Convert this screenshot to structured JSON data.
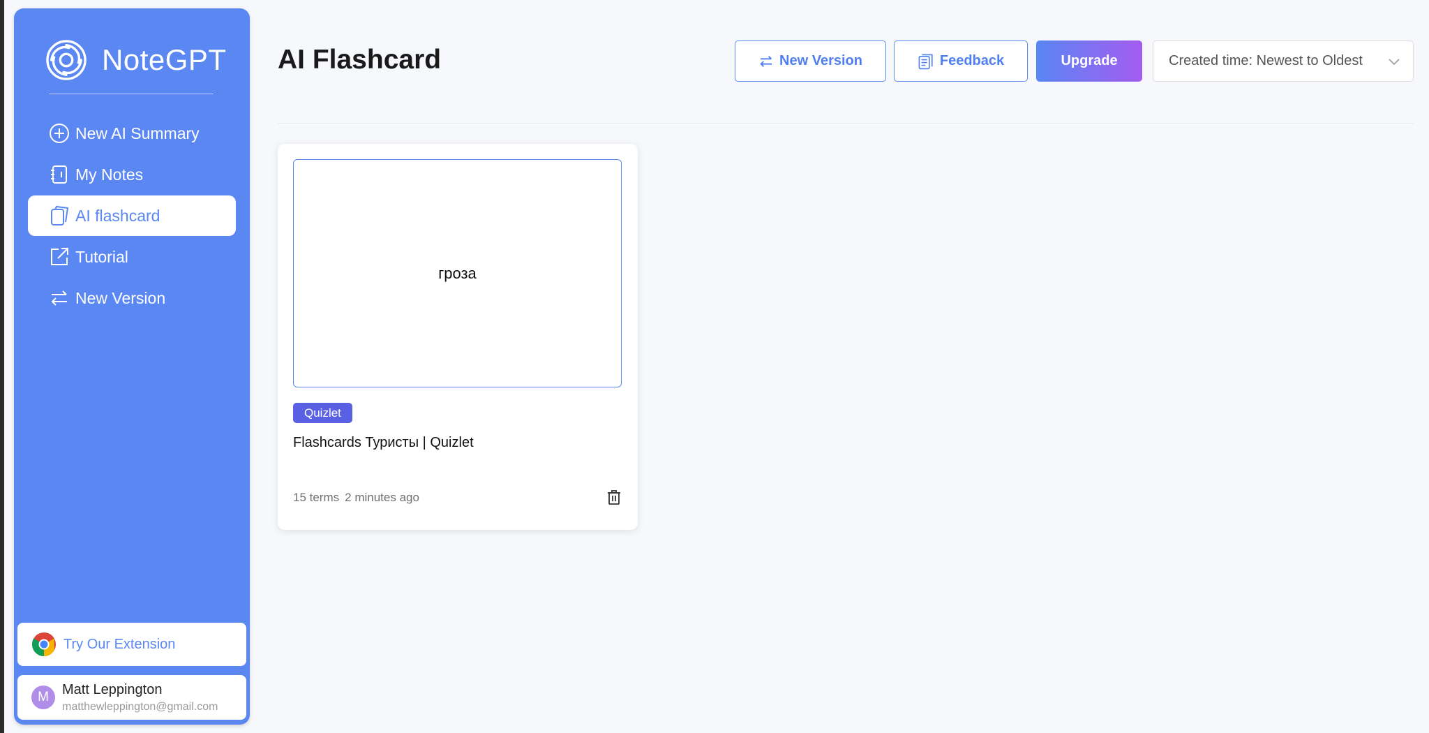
{
  "sidebar": {
    "brand": "NoteGPT",
    "items": [
      {
        "label": "New AI Summary",
        "icon": "plus-circle-icon"
      },
      {
        "label": "My Notes",
        "icon": "notebook-icon"
      },
      {
        "label": "AI flashcard",
        "icon": "flashcard-icon",
        "active": true
      },
      {
        "label": "Tutorial",
        "icon": "external-link-icon"
      },
      {
        "label": "New Version",
        "icon": "swap-arrows-icon"
      }
    ],
    "extension_label": "Try Our Extension",
    "user": {
      "initial": "M",
      "name": "Matt Leppington",
      "email": "matthewleppington@gmail.com"
    }
  },
  "header": {
    "title": "AI Flashcard",
    "new_version_label": "New Version",
    "feedback_label": "Feedback",
    "upgrade_label": "Upgrade",
    "sort_value": "Created time: Newest to Oldest"
  },
  "cards": [
    {
      "preview_text": "гроза",
      "tag": "Quizlet",
      "title": "Flashcards Туристы | Quizlet",
      "terms": "15 terms",
      "time": "2 minutes ago"
    }
  ],
  "colors": {
    "accent": "#5b87f2",
    "tag": "#5a60e4",
    "upgrade_start": "#5a86f4",
    "upgrade_end": "#a45cf0",
    "background": "#f6f8fc"
  }
}
